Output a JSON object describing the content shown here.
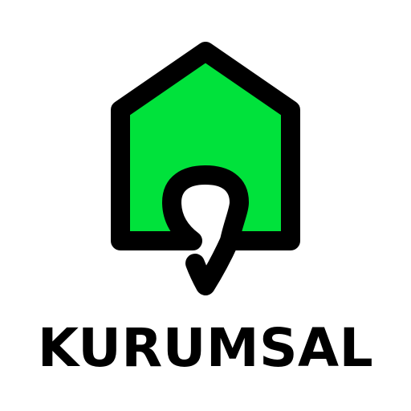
{
  "brand": {
    "name": "KURUMSAL"
  },
  "colors": {
    "house_fill": "#00E23B",
    "outline": "#000000",
    "background": "#FFFFFF"
  },
  "icons": {
    "logo": "house-with-location-pin-icon"
  }
}
